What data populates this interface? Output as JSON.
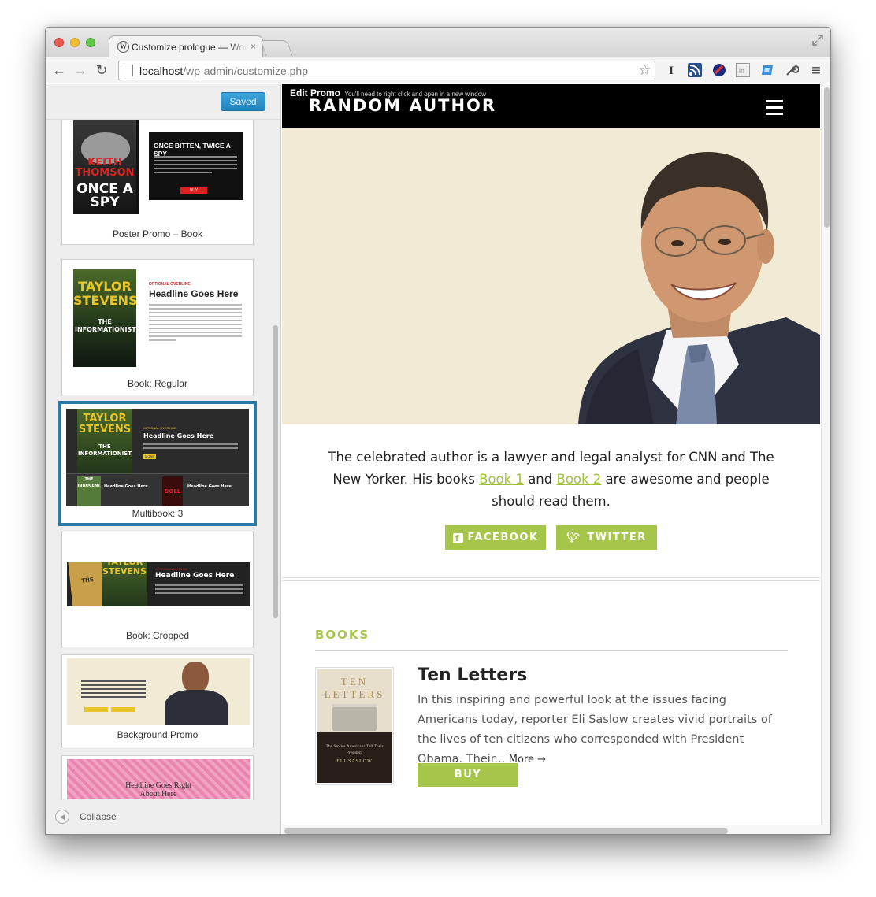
{
  "browser": {
    "tab_title": "Customize prologue — WordPress",
    "tab_close": "×",
    "url_host": "localhost",
    "url_path": "/wp-admin/customize.php",
    "back_glyph": "←",
    "forward_glyph": "→",
    "reload_glyph": "↻",
    "star_glyph": "☆",
    "menu_glyph": "≡"
  },
  "sidebar": {
    "saved_label": "Saved",
    "collapse_label": "Collapse",
    "templates": [
      {
        "label": "Poster Promo – Book"
      },
      {
        "label": "Book: Regular"
      },
      {
        "label": "Multibook: 3"
      },
      {
        "label": "Book: Cropped"
      },
      {
        "label": "Background Promo"
      }
    ],
    "thumb_text": {
      "poster_author": "KEITH THOMSON",
      "poster_title": "ONCE A SPY",
      "poster_headline": "ONCE BITTEN, TWICE A SPY",
      "poster_buy": "BUY",
      "taylor": "TAYLOR",
      "stevens": "STEVENS",
      "informationist": "THE INFORMATIONIST",
      "overline": "OPTIONAL OVERLINE",
      "headline": "Headline Goes Here",
      "more": "MORE",
      "innocent": "THE INNOCENT",
      "doll": "DOLL",
      "headline_right": "Headline Goes Right About Here"
    }
  },
  "preview": {
    "edit_promo": "Edit Promo",
    "edit_promo_note": "You'll need to right click and open in a new window",
    "site_title": "RANDOM AUTHOR",
    "bio_before": "The celebrated author is a lawyer and legal analyst for CNN and The New Yorker. His books ",
    "bio_link1": "Book 1",
    "bio_mid": " and ",
    "bio_link2": "Book 2",
    "bio_after": " are awesome and people should read them.",
    "facebook_label": "FACEBOOK",
    "twitter_label": "TWITTER",
    "books_heading": "BOOKS",
    "book": {
      "title": "Ten Letters",
      "cover_title": "TEN LETTERS",
      "cover_sub": "The Stories Americans Tell Their President",
      "cover_author": "ELI SASLOW",
      "description": "In this inspiring and powerful look at the issues facing Americans today, reporter Eli Saslow creates vivid portraits of the lives of ten citizens who corresponded with President Obama. Their...",
      "more_label": "More →",
      "buy_label": "BUY"
    }
  },
  "colors": {
    "accent_green": "#a5c64b",
    "saved_blue": "#2383bd",
    "selected_border": "#2a7aa8",
    "hero_bg": "#f1ead4"
  }
}
